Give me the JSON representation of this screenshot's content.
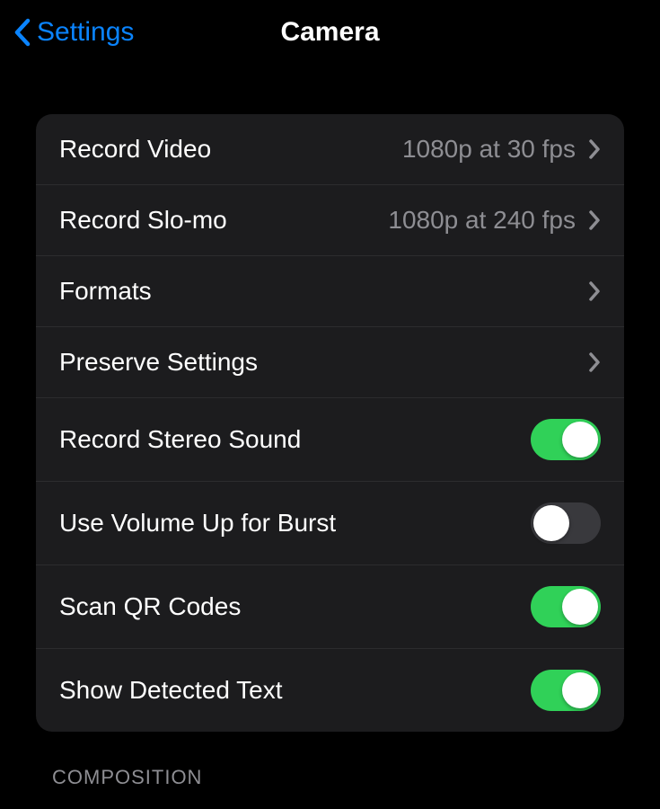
{
  "nav": {
    "back_label": "Settings",
    "title": "Camera"
  },
  "rows": {
    "record_video": {
      "label": "Record Video",
      "value": "1080p at 30 fps"
    },
    "record_slomo": {
      "label": "Record Slo-mo",
      "value": "1080p at 240 fps"
    },
    "formats": {
      "label": "Formats"
    },
    "preserve_settings": {
      "label": "Preserve Settings"
    },
    "record_stereo_sound": {
      "label": "Record Stereo Sound",
      "toggle": true
    },
    "volume_up_burst": {
      "label": "Use Volume Up for Burst",
      "toggle": false
    },
    "scan_qr": {
      "label": "Scan QR Codes",
      "toggle": true
    },
    "show_detected_text": {
      "label": "Show Detected Text",
      "toggle": true
    }
  },
  "section_header": "COMPOSITION"
}
